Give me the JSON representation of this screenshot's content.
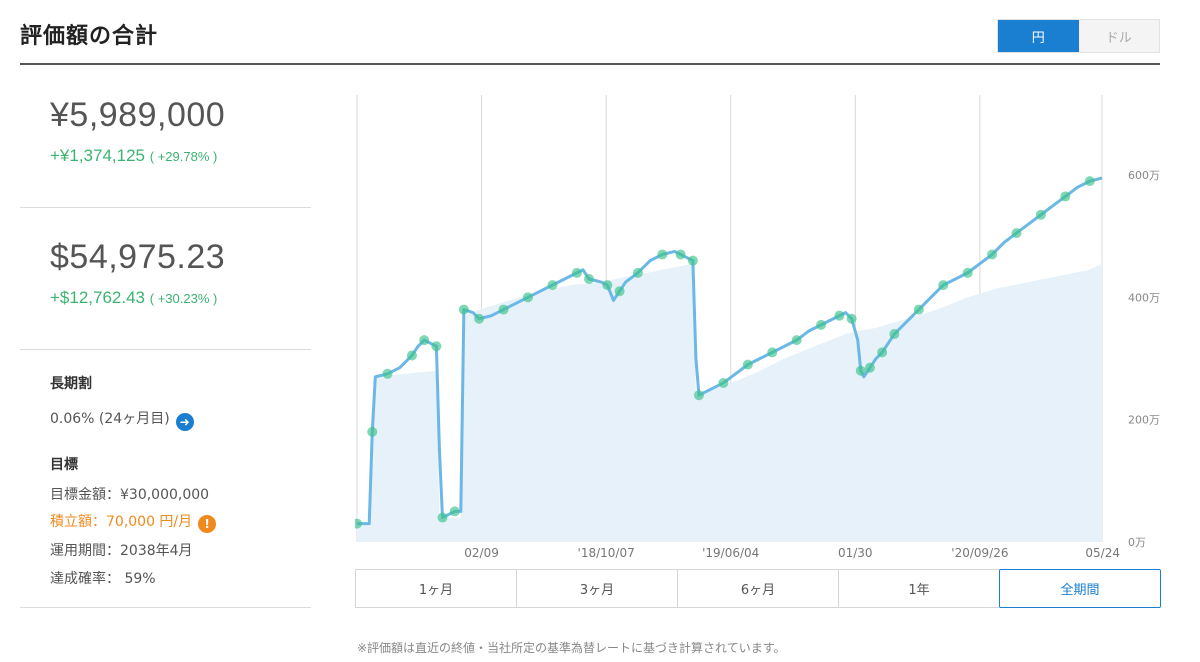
{
  "header": {
    "title": "評価額の合計",
    "currency_yen": "円",
    "currency_dollar": "ドル"
  },
  "yen_block": {
    "value": "¥5,989,000",
    "change": "+¥1,374,125",
    "change_pct": "( +29.78% )"
  },
  "usd_block": {
    "value": "$54,975.23",
    "change": "+$12,762.43",
    "change_pct": "( +30.23% )"
  },
  "long_term": {
    "title": "長期割",
    "value": "0.06% (24ヶ月目)"
  },
  "goal": {
    "title": "目標",
    "amount": "目標金額：¥30,000,000",
    "monthly": "積立額：70,000 円/月",
    "period": "運用期間：2038年4月",
    "probability": "達成確率： 59%"
  },
  "range_tabs": [
    {
      "label": "1ヶ月"
    },
    {
      "label": "3ヶ月"
    },
    {
      "label": "6ヶ月"
    },
    {
      "label": "1年"
    },
    {
      "label": "全期間"
    }
  ],
  "footnote": "※評価額は直近の終値・当社所定の基準為替レートに基づき計算されています。",
  "colors": {
    "accent": "#1a7fd0",
    "gain": "#3cb371",
    "warning": "#ef8a1f",
    "line": "#6bb8e6",
    "area": "#e6f1fa",
    "dot": "#3cc28a"
  },
  "chart_data": {
    "type": "line",
    "x_tick_labels": [
      "02/09",
      "'18/10/07",
      "'19/06/04",
      "01/30",
      "'20/09/26",
      "05/24"
    ],
    "y_tick_labels": [
      "600万",
      "400万",
      "200万",
      "0万"
    ],
    "ylim": [
      0,
      600
    ],
    "y_unit": "万円",
    "x_range": [
      0,
      100
    ],
    "x_ticks": [
      15.5,
      31,
      46.5,
      62,
      77.5,
      93
    ],
    "series": [
      {
        "role": "valuation",
        "points": [
          [
            0,
            30
          ],
          [
            2,
            30
          ],
          [
            2.5,
            180
          ],
          [
            3,
            270
          ],
          [
            5,
            275
          ],
          [
            7,
            285
          ],
          [
            9,
            305
          ],
          [
            10,
            320
          ],
          [
            11,
            330
          ],
          [
            12,
            325
          ],
          [
            13,
            320
          ],
          [
            13.5,
            150
          ],
          [
            14,
            40
          ],
          [
            15,
            45
          ],
          [
            16,
            50
          ],
          [
            17,
            50
          ],
          [
            17.5,
            380
          ],
          [
            19,
            375
          ],
          [
            20,
            365
          ],
          [
            22,
            370
          ],
          [
            24,
            380
          ],
          [
            26,
            390
          ],
          [
            28,
            400
          ],
          [
            30,
            410
          ],
          [
            32,
            420
          ],
          [
            34,
            430
          ],
          [
            36,
            440
          ],
          [
            37,
            445
          ],
          [
            38,
            430
          ],
          [
            40,
            425
          ],
          [
            41,
            420
          ],
          [
            42,
            395
          ],
          [
            43,
            410
          ],
          [
            44,
            425
          ],
          [
            46,
            440
          ],
          [
            48,
            460
          ],
          [
            50,
            470
          ],
          [
            52,
            475
          ],
          [
            53,
            470
          ],
          [
            54,
            465
          ],
          [
            55,
            460
          ],
          [
            55.5,
            300
          ],
          [
            56,
            240
          ],
          [
            58,
            250
          ],
          [
            60,
            260
          ],
          [
            62,
            275
          ],
          [
            64,
            290
          ],
          [
            66,
            300
          ],
          [
            68,
            310
          ],
          [
            70,
            320
          ],
          [
            72,
            330
          ],
          [
            74,
            345
          ],
          [
            76,
            355
          ],
          [
            78,
            365
          ],
          [
            79,
            370
          ],
          [
            80,
            375
          ],
          [
            81,
            365
          ],
          [
            82,
            330
          ],
          [
            82.5,
            280
          ],
          [
            83,
            270
          ],
          [
            84,
            285
          ],
          [
            85,
            300
          ],
          [
            86,
            310
          ],
          [
            87,
            325
          ],
          [
            88,
            340
          ],
          [
            90,
            360
          ],
          [
            92,
            380
          ],
          [
            94,
            400
          ],
          [
            96,
            420
          ],
          [
            98,
            430
          ],
          [
            100,
            440
          ],
          [
            102,
            455
          ],
          [
            104,
            470
          ],
          [
            106,
            490
          ],
          [
            108,
            505
          ],
          [
            110,
            520
          ],
          [
            112,
            535
          ],
          [
            114,
            550
          ],
          [
            116,
            565
          ],
          [
            118,
            580
          ],
          [
            120,
            590
          ],
          [
            122,
            595
          ]
        ]
      },
      {
        "role": "principal",
        "points": [
          [
            0,
            30
          ],
          [
            2,
            30
          ],
          [
            3,
            270
          ],
          [
            13,
            280
          ],
          [
            13.5,
            40
          ],
          [
            17,
            40
          ],
          [
            17.5,
            370
          ],
          [
            20,
            380
          ],
          [
            25,
            395
          ],
          [
            30,
            410
          ],
          [
            35,
            420
          ],
          [
            40,
            425
          ],
          [
            45,
            435
          ],
          [
            50,
            445
          ],
          [
            55,
            455
          ],
          [
            55.5,
            240
          ],
          [
            60,
            255
          ],
          [
            65,
            275
          ],
          [
            70,
            300
          ],
          [
            75,
            320
          ],
          [
            80,
            340
          ],
          [
            82,
            345
          ],
          [
            85,
            350
          ],
          [
            90,
            365
          ],
          [
            95,
            380
          ],
          [
            100,
            400
          ],
          [
            105,
            415
          ],
          [
            110,
            425
          ],
          [
            115,
            435
          ],
          [
            120,
            445
          ],
          [
            122,
            455
          ]
        ]
      }
    ],
    "legend": "none",
    "grid": "vertical"
  }
}
